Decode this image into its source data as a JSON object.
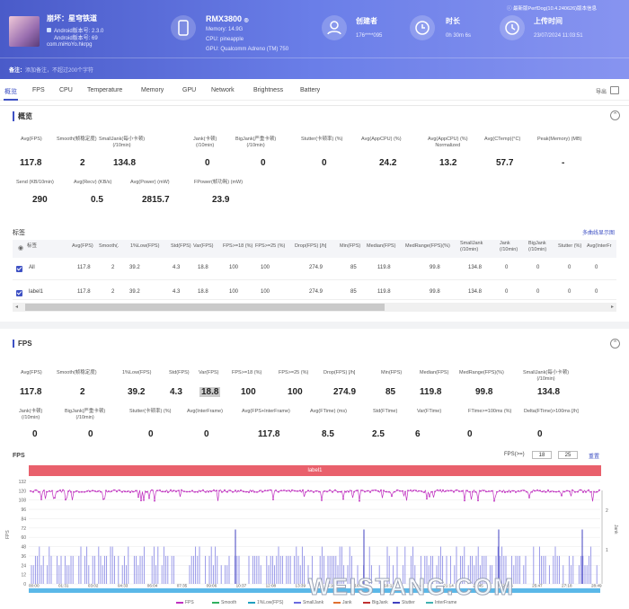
{
  "app": {
    "name": "崩坏：星穹铁道",
    "android_ver": "Android版本号: 2.3.0",
    "android_code": "Android版本号: 69",
    "package": "com.miHoYo.hkrpg"
  },
  "device": {
    "name": "RMX3800",
    "memory": "Memory: 14.9G",
    "cpu": "CPU: pineapple",
    "gpu": "GPU: Qualcomm Adreno (TM) 750"
  },
  "creator": {
    "title": "创建者",
    "value": "176****095"
  },
  "duration": {
    "title": "时长",
    "value": "0h 30m 6s"
  },
  "upload": {
    "title": "上传时间",
    "value": "23/07/2024 11:03:51",
    "link": "最新版PerfDog(10.4.240626)版本信息"
  },
  "note": {
    "label": "备注：",
    "placeholder": "添加备注，不超过200个字符"
  },
  "tabs": [
    "概览",
    "FPS",
    "CPU",
    "Temperature",
    "Memory",
    "GPU",
    "Network",
    "Brightness",
    "Battery"
  ],
  "export_label": "导出",
  "overview": {
    "title": "概览",
    "row1": [
      {
        "label": "Avg(FPS)",
        "value": "117.8"
      },
      {
        "label": "Smooth(帧稳定度)",
        "value": "2"
      },
      {
        "label": "SmallJank(每小卡顿)\n(/10min)",
        "value": "134.8"
      },
      {
        "label": "Jank(卡顿)\n(/10min)",
        "value": "0"
      },
      {
        "label": "BigJank(严重卡顿)\n(/10min)",
        "value": "0"
      },
      {
        "label": "Stutter(卡顿率) (%)",
        "value": "0"
      },
      {
        "label": "Avg(AppCPU) (%)",
        "value": "24.2"
      },
      {
        "label": "Avg(AppCPU) (%)\nNormalized",
        "value": "13.2"
      },
      {
        "label": "Avg(CTemp)(°C)",
        "value": "57.7"
      },
      {
        "label": "Peak(Memory) (MB)",
        "value": "-"
      }
    ],
    "row2": [
      {
        "label": "Send (KB/10min)",
        "value": "290"
      },
      {
        "label": "Avg(Recv) (KB/s)",
        "value": "0.5"
      },
      {
        "label": "Avg(Power) (mW)",
        "value": "2815.7"
      },
      {
        "label": "FPower(帧功耗) (mW)",
        "value": "23.9"
      }
    ]
  },
  "labels_table": {
    "title": "标签",
    "link": "多曲线显示图",
    "columns": [
      "标签",
      "Avg(FPS)",
      "Smooth(.",
      "1%Low(FPS)",
      "Std(FPS)",
      "Var(FPS)",
      "FPS>=18 (%)",
      "FPS>=25 (%)",
      "Drop(FPS) [/h]",
      "Min(FPS)",
      "Median(FPS)",
      "MedRange(FPS)(%)",
      "SmallJank\n(/10min)",
      "Jank\n(/10min)",
      "BigJank\n(/10min)",
      "Stutter (%)",
      "Avg(InterFr"
    ],
    "rows": [
      {
        "name": "All",
        "cells": [
          "117.8",
          "2",
          "39.2",
          "4.3",
          "18.8",
          "100",
          "100",
          "274.9",
          "85",
          "119.8",
          "99.8",
          "134.8",
          "0",
          "0",
          "0",
          "0"
        ]
      },
      {
        "name": "label1",
        "cells": [
          "117.8",
          "2",
          "39.2",
          "4.3",
          "18.8",
          "100",
          "100",
          "274.9",
          "85",
          "119.8",
          "99.8",
          "134.8",
          "0",
          "0",
          "0",
          "0"
        ]
      }
    ]
  },
  "fps_section": {
    "title": "FPS",
    "row1": [
      {
        "label": "Avg(FPS)",
        "value": "117.8"
      },
      {
        "label": "Smooth(帧稳定度)",
        "value": "2"
      },
      {
        "label": "1%Low(FPS)",
        "value": "39.2"
      },
      {
        "label": "Std(FPS)",
        "value": "4.3"
      },
      {
        "label": "Var(FPS)",
        "value": "18.8"
      },
      {
        "label": "FPS>=18 (%)",
        "value": "100"
      },
      {
        "label": "FPS>=25 (%)",
        "value": "100"
      },
      {
        "label": "Drop(FPS) [/h]",
        "value": "274.9"
      },
      {
        "label": "Min(FPS)",
        "value": "85"
      },
      {
        "label": "Median(FPS)",
        "value": "119.8"
      },
      {
        "label": "MedRange(FPS)(%)",
        "value": "99.8"
      },
      {
        "label": "SmallJank(每小卡顿)\n(/10min)",
        "value": "134.8"
      }
    ],
    "row2": [
      {
        "label": "Jank(卡顿)\n(/10min)",
        "value": "0"
      },
      {
        "label": "BigJank(严重卡顿)\n(/10min)",
        "value": "0"
      },
      {
        "label": "Stutter(卡顿率) (%)",
        "value": "0"
      },
      {
        "label": "Avg(InterFrame)",
        "value": "0"
      },
      {
        "label": "Avg(FPS+InterFrame)",
        "value": "117.8"
      },
      {
        "label": "Avg(FTime) (ms)",
        "value": "8.5"
      },
      {
        "label": "Std(FTime)",
        "value": "2.5"
      },
      {
        "label": "Var(FTime)",
        "value": "6"
      },
      {
        "label": "FTime>=100ms (%)",
        "value": "0"
      },
      {
        "label": "Delta(FTime)>100ms [/h]",
        "value": "0"
      }
    ],
    "chart_label": "FPS",
    "fps_filter_label": "FPS(>=)",
    "fps_inputs": [
      "18",
      "25"
    ],
    "reset_label": "重置",
    "band_label": "label1"
  },
  "chart_data": {
    "type": "line",
    "ylabel": "FPS",
    "y_ticks": [
      0,
      12,
      24,
      36,
      48,
      60,
      72,
      84,
      96,
      108,
      120,
      132
    ],
    "ylim": [
      0,
      132
    ],
    "x_ticks": [
      "00:00",
      "01:31",
      "03:02",
      "04:33",
      "06:04",
      "07:35",
      "09:06",
      "10:37",
      "12:08",
      "13:39",
      "15:10",
      "16:41",
      "18:12",
      "19:43",
      "21:14",
      "22:45",
      "24:16",
      "25:47",
      "27:18",
      "28:49"
    ],
    "right_axis": {
      "label": "Jank",
      "ticks": [
        1,
        2
      ]
    },
    "series": [
      {
        "name": "FPS",
        "color": "#c030c0",
        "typical": 119
      },
      {
        "name": "Smooth",
        "color": "#30b060"
      },
      {
        "name": "1%Low(FPS)",
        "color": "#20a0c0"
      },
      {
        "name": "SmallJank",
        "color": "#6a6adf"
      },
      {
        "name": "Jank",
        "color": "#e07030"
      },
      {
        "name": "BigJank",
        "color": "#c03030"
      },
      {
        "name": "Stutter",
        "color": "#4040c0"
      },
      {
        "name": "InterFrame",
        "color": "#40b0b0"
      }
    ]
  }
}
